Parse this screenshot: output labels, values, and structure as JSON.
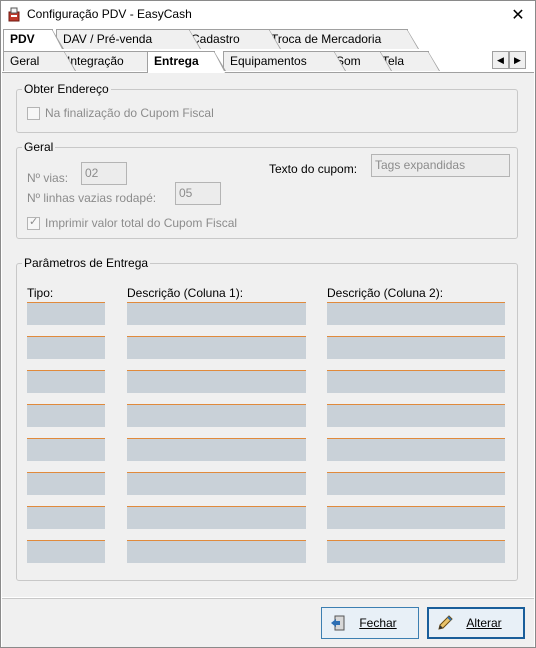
{
  "window": {
    "title": "Configuração PDV - EasyCash"
  },
  "tabs_top": [
    {
      "label": "PDV"
    },
    {
      "label": "DAV / Pré-venda"
    },
    {
      "label": "Cadastro"
    },
    {
      "label": "Troca de Mercadoria"
    }
  ],
  "tabs_sub": [
    {
      "label": "Geral"
    },
    {
      "label": "Integração"
    },
    {
      "label": "Entrega"
    },
    {
      "label": "Equipamentos"
    },
    {
      "label": "Som"
    },
    {
      "label": "Tela"
    }
  ],
  "obter_endereco": {
    "title": "Obter Endereço",
    "checkbox_label": "Na finalização do Cupom Fiscal",
    "checked": false
  },
  "geral": {
    "title": "Geral",
    "vias_label": "Nº vias:",
    "vias_value": "02",
    "linhas_label": "Nº linhas vazias rodapé:",
    "linhas_value": "05",
    "texto_cupom_label": "Texto do cupom:",
    "texto_cupom_value": "Tags expandidas",
    "imprimir_label": "Imprimir valor total do Cupom Fiscal",
    "imprimir_checked": true
  },
  "parametros": {
    "title": "Parâmetros de Entrega",
    "col_tipo": "Tipo:",
    "col_desc1": "Descrição (Coluna 1):",
    "col_desc2": "Descrição (Coluna 2):",
    "row_count": 8
  },
  "footer": {
    "fechar_label": "Fechar",
    "alterar_label": "Alterar"
  }
}
